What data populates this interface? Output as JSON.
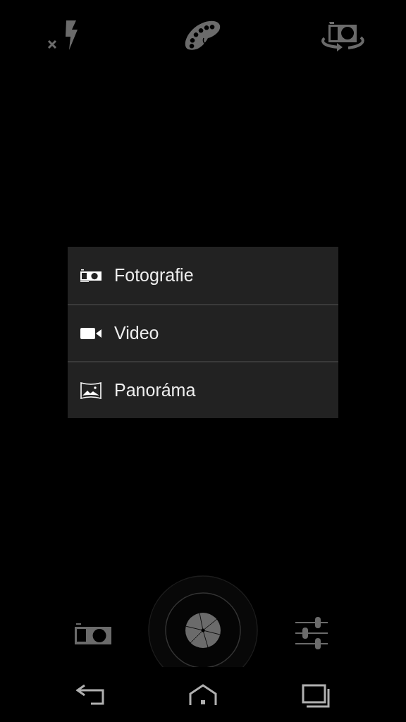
{
  "mode_menu": {
    "items": [
      {
        "kind": "photo",
        "label": "Fotografie"
      },
      {
        "kind": "video",
        "label": "Video"
      },
      {
        "kind": "panorama",
        "label": "Panoráma"
      }
    ]
  }
}
